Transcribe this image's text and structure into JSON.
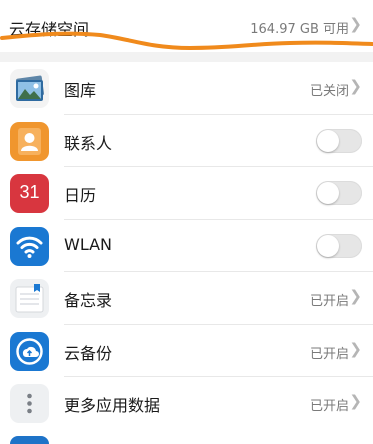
{
  "storage": {
    "title": "云存储空间",
    "value": "164.97 GB 可用"
  },
  "items": [
    {
      "label": "图库",
      "status": "已关闭",
      "icon": "gallery-icon",
      "control": "status"
    },
    {
      "label": "联系人",
      "icon": "contacts-icon",
      "control": "toggle",
      "toggle_on": false
    },
    {
      "label": "日历",
      "icon": "calendar-icon",
      "icon_text": "31",
      "control": "toggle",
      "toggle_on": false
    },
    {
      "label": "WLAN",
      "icon": "wlan-icon",
      "control": "toggle",
      "toggle_on": false
    },
    {
      "label": "备忘录",
      "status": "已开启",
      "icon": "notepad-icon",
      "control": "status"
    },
    {
      "label": "云备份",
      "status": "已开启",
      "icon": "cloud-backup-icon",
      "control": "status"
    },
    {
      "label": "更多应用数据",
      "status": "已开启",
      "icon": "more-apps-icon",
      "control": "status"
    }
  ],
  "colors": {
    "scribble": "#f08a1c",
    "contacts": "#f0962e",
    "calendar": "#d8363f",
    "wlan": "#1a78d2",
    "cloud_backup": "#1a78d2"
  }
}
